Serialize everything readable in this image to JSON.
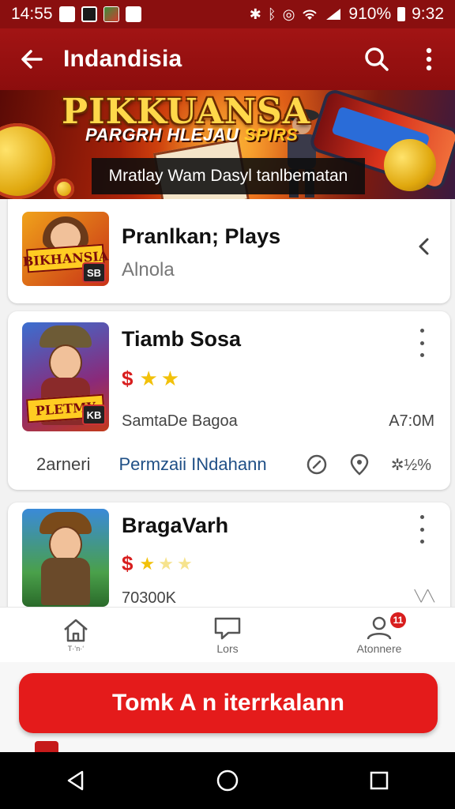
{
  "status_bar": {
    "time_left": "14:55",
    "battery": "910%",
    "clock": "9:32"
  },
  "app_bar": {
    "title": "Indandisia"
  },
  "banner": {
    "heading": "PIKKUANSA",
    "subheading_main": "PARGRH HLEJAU",
    "subheading_accent": "SPIRS",
    "caption": "Mratlay Wam Dasyl tanlbematan"
  },
  "items": [
    {
      "title": "Pranlkan; Plays",
      "subtitle": "Alnola",
      "thumb_tag": "BIKHANSIA",
      "thumb_badge": "SB"
    },
    {
      "title": "Tiamb Sosa",
      "rating": 2,
      "price_symbol": "$",
      "info": "SamtaDe Bagoa",
      "time": "A7:0M",
      "footer_left": "2arneri",
      "footer_link": "Permzaii INdahann",
      "footer_stat": "✲½%",
      "thumb_tag": "PLETMY",
      "thumb_badge": "KB"
    },
    {
      "title": "BragaVarh",
      "rating": 1.5,
      "price_symbol": "$",
      "info": "70300K",
      "time": "╲╱╲"
    }
  ],
  "bottom_nav": [
    {
      "label": "T·ʻn·ʻ",
      "icon": "home-icon"
    },
    {
      "label": "Lors",
      "icon": "chat-icon"
    },
    {
      "label": "Atonnere",
      "icon": "profile-icon",
      "badge": "11"
    }
  ],
  "cta": {
    "label": "Tomk A n iterrkalann"
  },
  "colors": {
    "primary": "#a21414",
    "accent": "#e41b1b",
    "star": "#f2c10a",
    "link": "#1f4f86"
  }
}
